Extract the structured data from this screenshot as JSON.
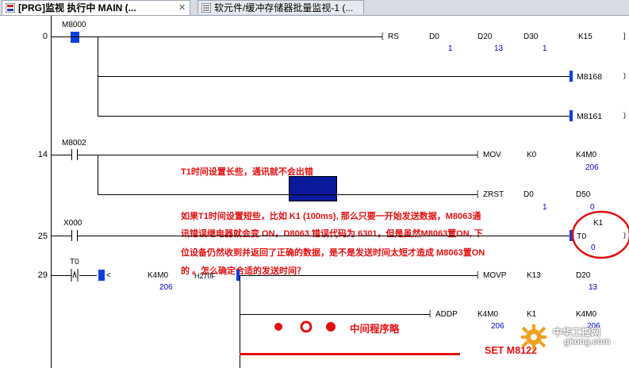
{
  "tabs": [
    {
      "label": "[PRG]监视 执行中 MAIN (...",
      "close": "✕",
      "icon": "program-icon"
    },
    {
      "label": "软元件/缓冲存储器批量监视-1 (...",
      "icon": "monitor-icon"
    }
  ],
  "rungs": [
    "0",
    "14",
    "25",
    "29"
  ],
  "contacts": {
    "m8000": "M8000",
    "m8002": "M8002",
    "x000": "X000",
    "t0": "T0"
  },
  "instructions": {
    "rs": {
      "op": "RS",
      "a1": "D0",
      "a2": "D20",
      "a3": "D30",
      "a4": "K15",
      "v1": "1",
      "v2": "13",
      "v3": "1"
    },
    "coil_m8168": "M8168",
    "coil_m8161": "M8161",
    "mov": {
      "op": "MOV",
      "a1": "K0",
      "a2": "K4M0",
      "v2": "206"
    },
    "zrst": {
      "op": "ZRST",
      "a1": "D0",
      "a2": "D50",
      "v1": "1",
      "v2": "0"
    },
    "timer": {
      "name": "T0",
      "preset": "K1",
      "value": "0"
    },
    "cmp": {
      "op": "<",
      "a1": "K4M0",
      "v1": "206",
      "a2": "H270F"
    },
    "movp": {
      "op": "MOVP",
      "a1": "K13",
      "a2": "D20",
      "v2": "13"
    },
    "addp": {
      "op": "ADDP",
      "a1": "K4M0",
      "a2": "K1",
      "a3": "K4M0",
      "v1": "206",
      "v3": "206"
    }
  },
  "annotations": {
    "note1": "T1时间设置长些，通讯就不会出错",
    "note2_line1": "如果T1时间设置短些，比如 K1 (100ms), 那么只要一开始发送数据，M8063通",
    "note2_line2": "讯错误继电器就会变 ON，D8063 错误代码为 6301，但是虽然M8063置ON, 下",
    "note2_line3": "位设备仍然收到并返回了正确的数据，是不是发送时间太短才造成 M8063置ON",
    "note2_line4": "的 。怎么确定合适的发送时间？",
    "mid": "中间程序略",
    "set": "SET M8122"
  },
  "watermark": {
    "line1": "中华工控网",
    "line2": "gkong.com"
  },
  "colors": {
    "accent_red": "#e01010",
    "value_blue": "#0000cc",
    "highlight_navy": "#0a1a9a"
  }
}
